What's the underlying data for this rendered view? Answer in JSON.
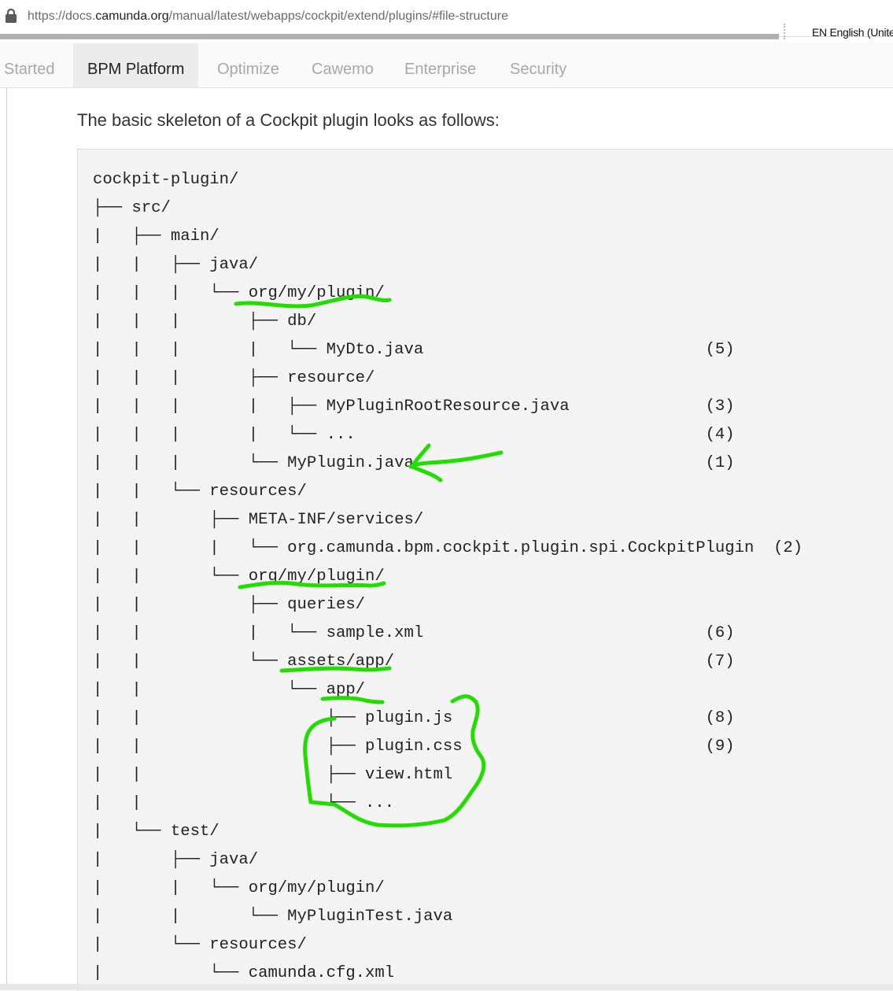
{
  "browser": {
    "url_prefix": "https://docs.",
    "url_host": "camunda.org",
    "url_path": "/manual/latest/webapps/cockpit/extend/plugins/#file-structure",
    "language": "EN English (Unite"
  },
  "topnav": {
    "tabs": [
      {
        "label": "Started",
        "active": false
      },
      {
        "label": "BPM Platform",
        "active": true
      },
      {
        "label": "Optimize",
        "active": false
      },
      {
        "label": "Cawemo",
        "active": false
      },
      {
        "label": "Enterprise",
        "active": false
      },
      {
        "label": "Security",
        "active": false
      }
    ]
  },
  "content": {
    "intro": "The basic skeleton of a Cockpit plugin looks as follows:",
    "code_lines": [
      "cockpit-plugin/",
      "├── src/",
      "|   ├── main/",
      "|   |   ├── java/",
      "|   |   |   └── org/my/plugin/",
      "|   |   |       ├── db/",
      "|   |   |       |   └── MyDto.java                             (5)",
      "|   |   |       ├── resource/",
      "|   |   |       |   ├── MyPluginRootResource.java              (3)",
      "|   |   |       |   └── ...                                    (4)",
      "|   |   |       └── MyPlugin.java                              (1)",
      "|   |   └── resources/",
      "|   |       ├── META-INF/services/",
      "|   |       |   └── org.camunda.bpm.cockpit.plugin.spi.CockpitPlugin  (2)",
      "|   |       └── org/my/plugin/",
      "|   |           ├── queries/",
      "|   |           |   └── sample.xml                             (6)",
      "|   |           └── assets/app/                                (7)",
      "|   |               └── app/",
      "|   |                   ├── plugin.js                          (8)",
      "|   |                   ├── plugin.css                         (9)",
      "|   |                   ├── view.html",
      "|   |                   └── ...",
      "|   └── test/",
      "|       ├── java/",
      "|       |   └── org/my/plugin/",
      "|       |       └── MyPluginTest.java",
      "|       └── resources/",
      "|           └── camunda.cfg.xml"
    ]
  },
  "colors": {
    "annotation": "#22dd00",
    "active_tab_bg": "#ececec",
    "code_bg": "#f4f4f4"
  }
}
